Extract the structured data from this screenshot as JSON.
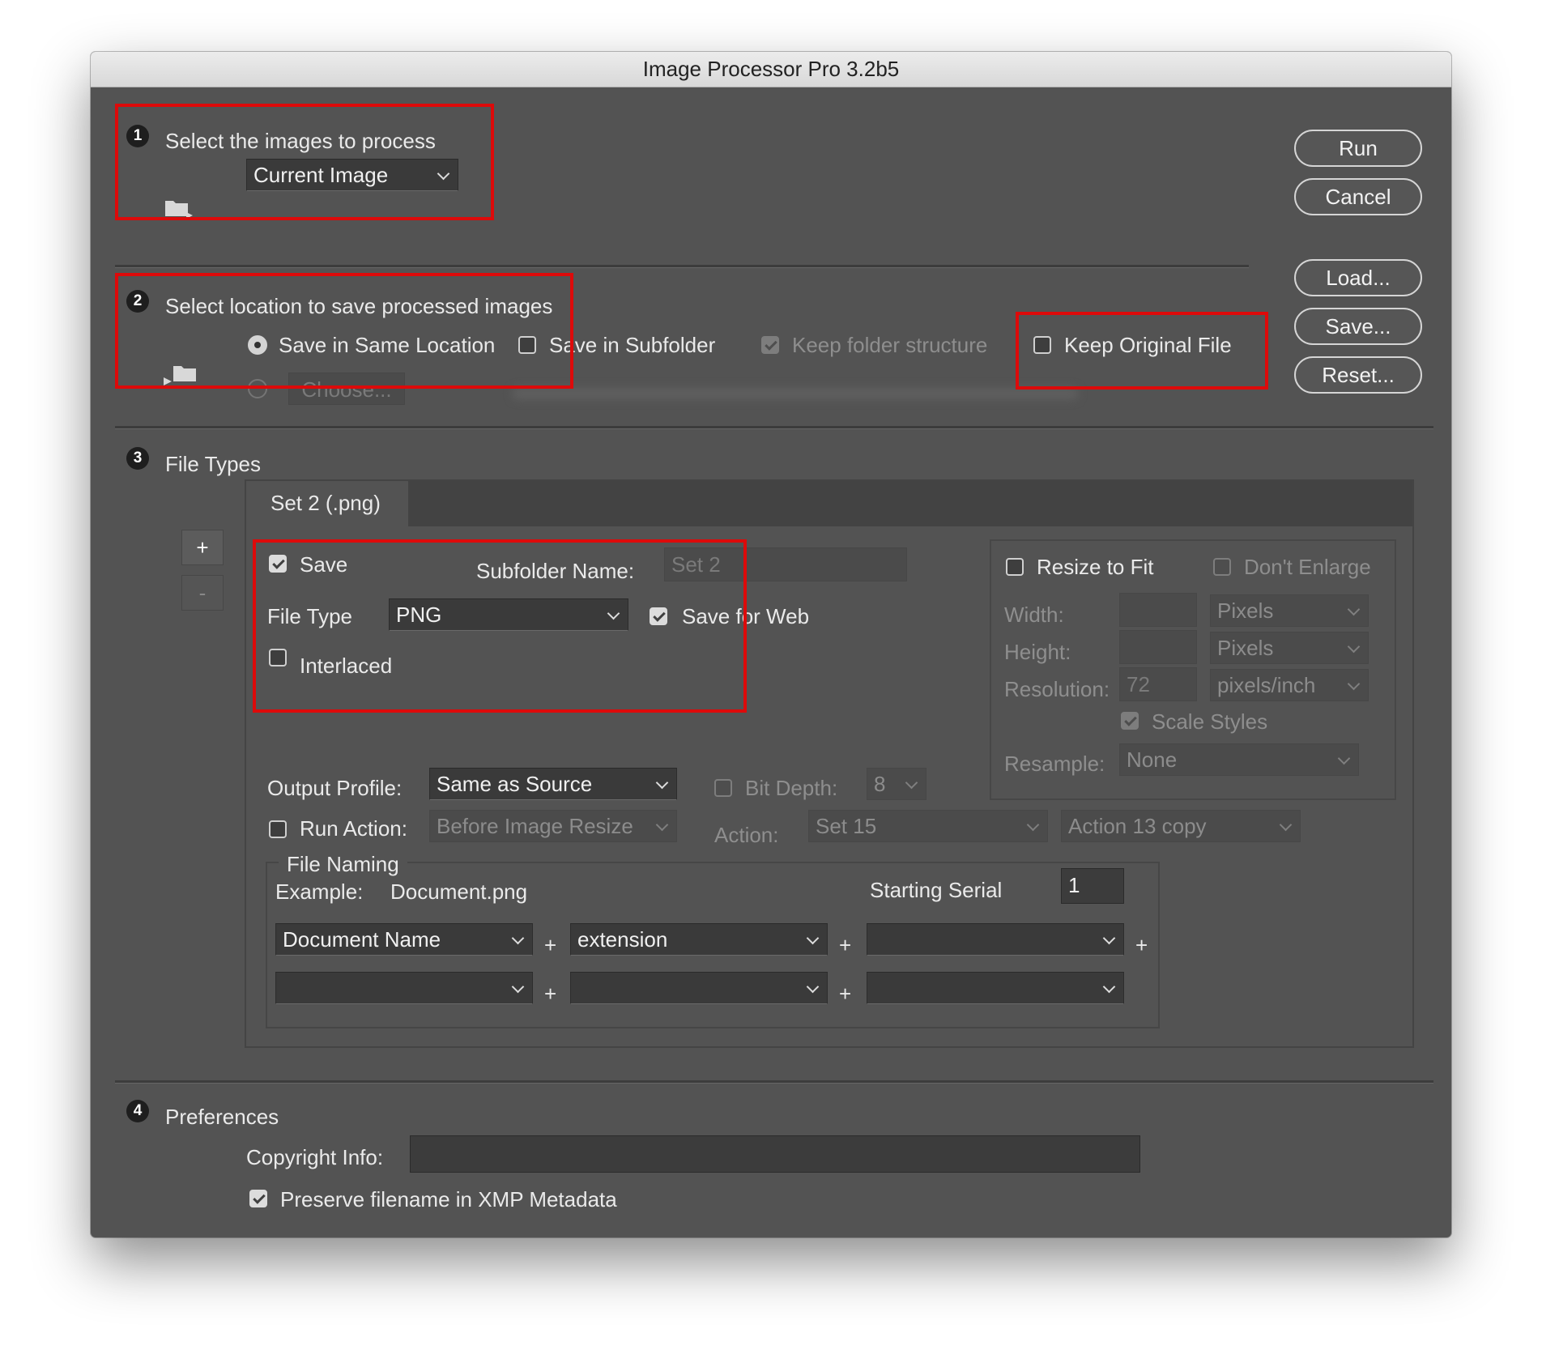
{
  "window": {
    "title": "Image Processor Pro 3.2b5"
  },
  "buttons": {
    "run": "Run",
    "cancel": "Cancel",
    "load": "Load...",
    "save": "Save...",
    "reset": "Reset..."
  },
  "section1": {
    "number": "1",
    "heading": "Select the images to process",
    "source_select": "Current Image"
  },
  "section2": {
    "number": "2",
    "heading": "Select location to save processed images",
    "save_same_location": "Save in Same Location",
    "save_in_subfolder": "Save in Subfolder",
    "keep_folder_structure": "Keep folder structure",
    "keep_original_file": "Keep Original File",
    "choose": "Choose..."
  },
  "section3": {
    "number": "3",
    "heading": "File Types",
    "tab_label": "Set 2 (.png)",
    "add_set": "+",
    "remove_set": "-",
    "save_label": "Save",
    "subfolder_name_label": "Subfolder Name:",
    "subfolder_name_value": "Set 2",
    "file_type_label": "File Type",
    "file_type_value": "PNG",
    "save_for_web": "Save for Web",
    "interlaced": "Interlaced",
    "resize_to_fit": "Resize to Fit",
    "dont_enlarge": "Don't Enlarge",
    "width_label": "Width:",
    "height_label": "Height:",
    "resolution_label": "Resolution:",
    "width_unit": "Pixels",
    "height_unit": "Pixels",
    "resolution_value": "72",
    "resolution_unit": "pixels/inch",
    "scale_styles": "Scale Styles",
    "resample_label": "Resample:",
    "resample_value": "None",
    "output_profile_label": "Output Profile:",
    "output_profile_value": "Same as Source",
    "bit_depth_label": "Bit Depth:",
    "bit_depth_value": "8",
    "run_action_label": "Run Action:",
    "run_action_when": "Before Image Resize",
    "action_label": "Action:",
    "action_set": "Set 15",
    "action_name": "Action 13 copy",
    "file_naming": {
      "legend": "File Naming",
      "example_label": "Example:",
      "example_value": "Document.png",
      "starting_serial_label": "Starting Serial",
      "starting_serial_value": "1",
      "row1": [
        "Document Name",
        "extension",
        ""
      ],
      "row2": [
        "",
        "",
        ""
      ],
      "plus": "+"
    }
  },
  "section4": {
    "number": "4",
    "heading": "Preferences",
    "copyright_label": "Copyright Info:",
    "copyright_value": "",
    "preserve_filename": "Preserve filename in XMP Metadata"
  },
  "colors": {
    "window_bg": "#535353",
    "highlight_box": "#dd0a0a",
    "titlebar": "#e2e2e2"
  }
}
